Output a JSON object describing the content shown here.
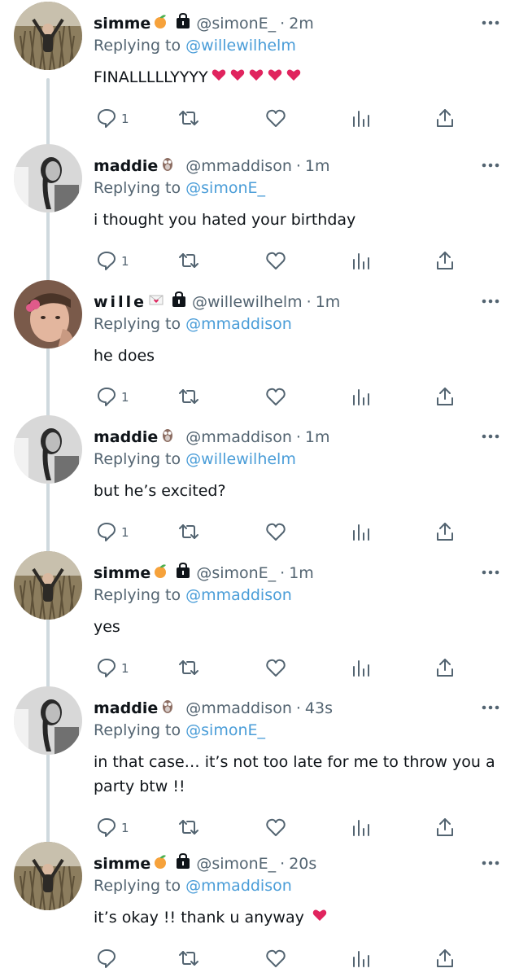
{
  "tweets": [
    {
      "name": "simme",
      "emoji": "peach-emoji",
      "locked": true,
      "handle": "@simonE_",
      "sep": "·",
      "time": "2m",
      "replying_prefix": "Replying to ",
      "replying_handle": "@willewilhelm",
      "text": "FINALLLLLYYYY",
      "text_emoji": "hearts-emoji",
      "text_emoji_count": 5,
      "reply_count": "1"
    },
    {
      "name": "maddie",
      "emoji": "owl-emoji",
      "locked": false,
      "handle": "@mmaddison",
      "sep": "·",
      "time": "1m",
      "replying_prefix": "Replying to ",
      "replying_handle": "@simonE_",
      "text": "i thought you hated your birthday",
      "reply_count": "1"
    },
    {
      "name": "wille",
      "emoji": "love-letter-emoji",
      "locked": true,
      "handle": "@willewilhelm",
      "sep": "·",
      "time": "1m",
      "replying_prefix": "Replying to ",
      "replying_handle": "@mmaddison",
      "text": "he does",
      "reply_count": "1"
    },
    {
      "name": "maddie",
      "emoji": "owl-emoji",
      "locked": false,
      "handle": "@mmaddison",
      "sep": "·",
      "time": "1m",
      "replying_prefix": "Replying to ",
      "replying_handle": "@willewilhelm",
      "text": "but he’s excited?",
      "reply_count": "1"
    },
    {
      "name": "simme",
      "emoji": "peach-emoji",
      "locked": true,
      "handle": "@simonE_",
      "sep": "·",
      "time": "1m",
      "replying_prefix": "Replying to ",
      "replying_handle": "@mmaddison",
      "text": "yes",
      "reply_count": "1"
    },
    {
      "name": "maddie",
      "emoji": "owl-emoji",
      "locked": false,
      "handle": "@mmaddison",
      "sep": "·",
      "time": "43s",
      "replying_prefix": "Replying to ",
      "replying_handle": "@simonE_",
      "text": "in that case… it’s not too late for me to throw you a party btw !!",
      "reply_count": "1"
    },
    {
      "name": "simme",
      "emoji": "peach-emoji",
      "locked": true,
      "handle": "@simonE_",
      "sep": "·",
      "time": "20s",
      "replying_prefix": "Replying to ",
      "replying_handle": "@mmaddison",
      "text": "it’s okay !! thank u anyway",
      "text_emoji": "heart-emoji",
      "text_emoji_count": 1,
      "reply_count": ""
    }
  ],
  "icons": {
    "reply": "reply-icon",
    "retweet": "retweet-icon",
    "like": "like-icon",
    "analytics": "analytics-icon",
    "share": "share-icon",
    "more": "more-icon",
    "lock": "lock-icon"
  },
  "colors": {
    "link": "#4a9dd8",
    "secondary": "#536471",
    "text": "#0f1419",
    "thread_line": "#cfd9de",
    "heart": "#e0245e"
  }
}
